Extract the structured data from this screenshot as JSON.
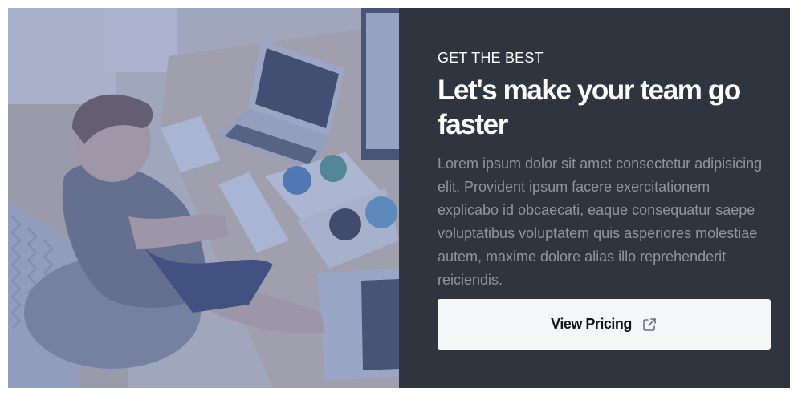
{
  "hero": {
    "eyebrow": "GET THE BEST",
    "headline": "Let's make your team go faster",
    "body": "Lorem ipsum dolor sit amet consectetur adipisicing elit. Provident ipsum facere exercitationem explicabo id obcaecati, eaque consequatur saepe voluptatibus voluptatem quis asperiores molestiae autem, maxime dolore alias illo reprehenderit reiciendis.",
    "cta_label": "View Pricing",
    "cta_icon": "external-link-icon",
    "image_icon": "workspace-photo"
  },
  "colors": {
    "panel_background": "#2f353f",
    "photo_overlay": "#5a6fb0",
    "body_text": "#8f959e",
    "button_background": "#f5f6f8"
  }
}
